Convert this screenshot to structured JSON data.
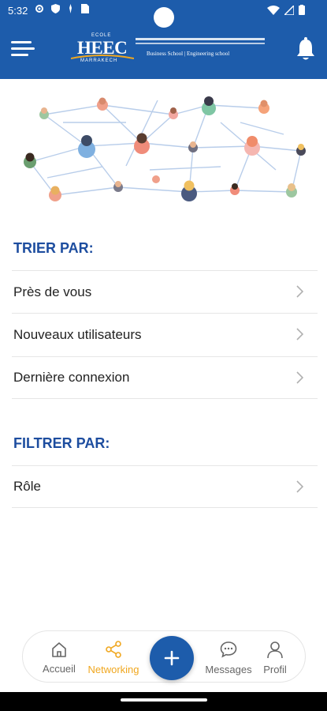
{
  "status_bar": {
    "time": "5:32"
  },
  "header": {
    "logo": {
      "ecole": "ECOLE",
      "name": "HEEC",
      "city": "MARRAKECH",
      "schools": "Business School  |  Engineering school"
    }
  },
  "sort_section": {
    "title": "TRIER PAR:",
    "items": [
      {
        "label": "Près de vous"
      },
      {
        "label": "Nouveaux utilisateurs"
      },
      {
        "label": "Dernière connexion"
      }
    ]
  },
  "filter_section": {
    "title": "FILTRER PAR:",
    "items": [
      {
        "label": "Rôle"
      }
    ]
  },
  "bottom_nav": {
    "items": [
      {
        "label": "Accueil",
        "icon": "home-icon"
      },
      {
        "label": "Networking",
        "icon": "share-icon",
        "active": true
      },
      {
        "label": "Messages",
        "icon": "chat-bubble-icon"
      },
      {
        "label": "Profil",
        "icon": "person-icon"
      }
    ],
    "fab_icon": "plus-icon"
  },
  "colors": {
    "primary": "#1d5cab",
    "section_title": "#1d4d9f",
    "active_nav": "#f0a71f"
  }
}
